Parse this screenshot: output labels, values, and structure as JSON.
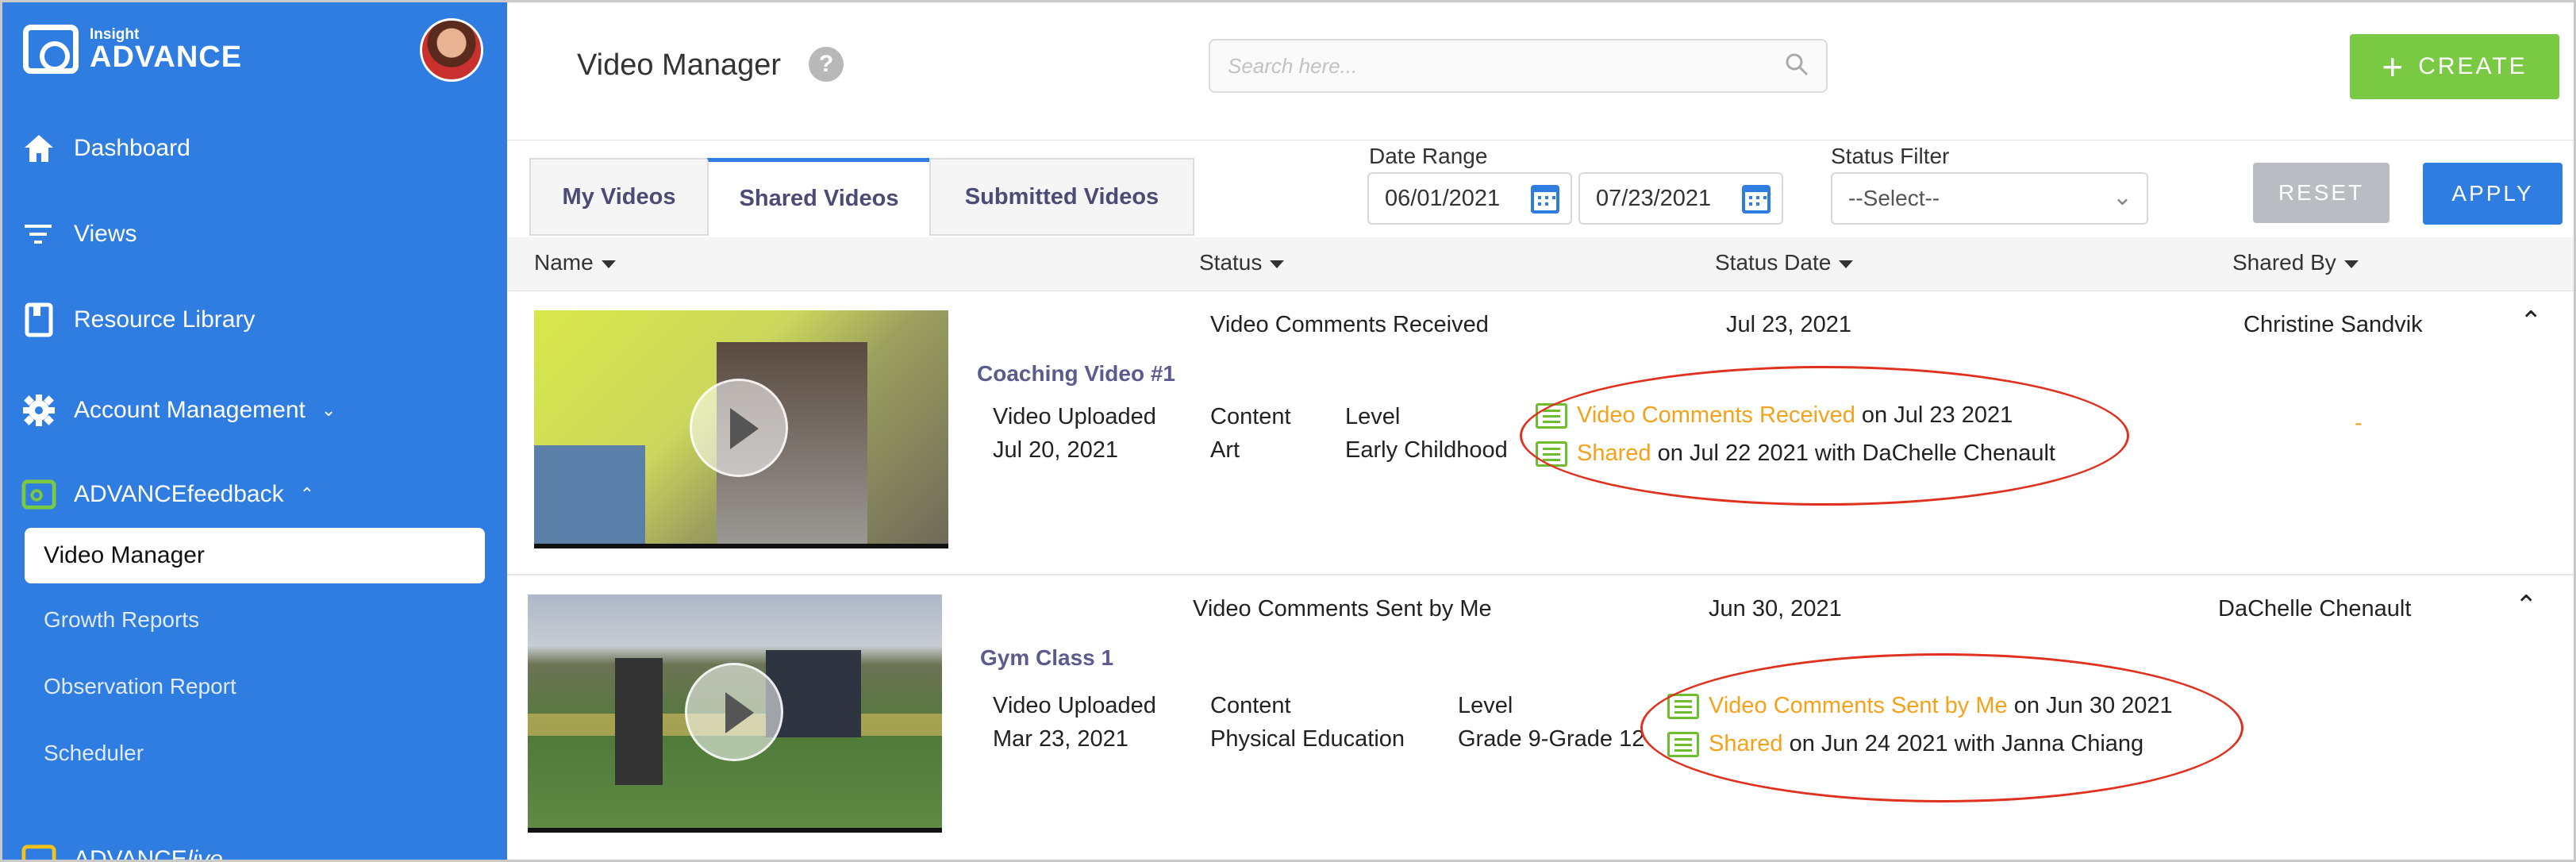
{
  "app": {
    "logo_small": "Insight",
    "logo_big": "ADVANCE"
  },
  "sidebar": {
    "items": [
      {
        "label": "Dashboard"
      },
      {
        "label": "Views"
      },
      {
        "label": "Resource Library"
      },
      {
        "label": "Account Management"
      },
      {
        "label": "ADVANCEfeedback"
      }
    ],
    "active": "Video Manager",
    "sub_items": [
      "Growth Reports",
      "Observation Report",
      "Scheduler"
    ],
    "bottom_prefix": "ADVANCE",
    "bottom_suffix": "live"
  },
  "header": {
    "title": "Video Manager",
    "help": "?",
    "search_placeholder": "Search here...",
    "create_label": "CREATE"
  },
  "tabs": [
    "My Videos",
    "Shared Videos",
    "Submitted Videos"
  ],
  "filters": {
    "date_range_label": "Date Range",
    "start_date": "06/01/2021",
    "end_date": "07/23/2021",
    "status_label": "Status Filter",
    "status_value": "--Select--",
    "reset": "RESET",
    "apply": "APPLY"
  },
  "columns": [
    "Name",
    "Status",
    "Status Date",
    "Shared By"
  ],
  "videos": [
    {
      "title": "Coaching Video #1",
      "status": "Video Comments Received",
      "status_date": "Jul 23, 2021",
      "shared_by": "Christine Sandvik",
      "uploaded_label": "Video Uploaded",
      "uploaded": "Jul 20, 2021",
      "content_label": "Content",
      "content": "Art",
      "level_label": "Level",
      "level": "Early Childhood",
      "dash": "-",
      "act1_status": "Video Comments Received",
      "act1_rest": " on Jul 23 2021",
      "act2_status": "Shared",
      "act2_rest": " on Jul 22 2021 with  DaChelle Chenault"
    },
    {
      "title": "Gym Class 1",
      "status": "Video Comments Sent by Me",
      "status_date": "Jun 30, 2021",
      "shared_by": "DaChelle Chenault",
      "uploaded_label": "Video Uploaded",
      "uploaded": "Mar 23, 2021",
      "content_label": "Content",
      "content": "Physical Education",
      "level_label": "Level",
      "level": "Grade 9-Grade 12",
      "act1_status": "Video Comments Sent by Me",
      "act1_rest": " on Jun 30 2021",
      "act2_status": "Shared",
      "act2_rest": " on Jun 24 2021 with Janna Chiang"
    }
  ],
  "colors": {
    "sidebar": "#2f7de1",
    "create": "#7ac943",
    "apply": "#2f7de1",
    "status": "#f4a21b",
    "annotation": "#e0301e"
  }
}
